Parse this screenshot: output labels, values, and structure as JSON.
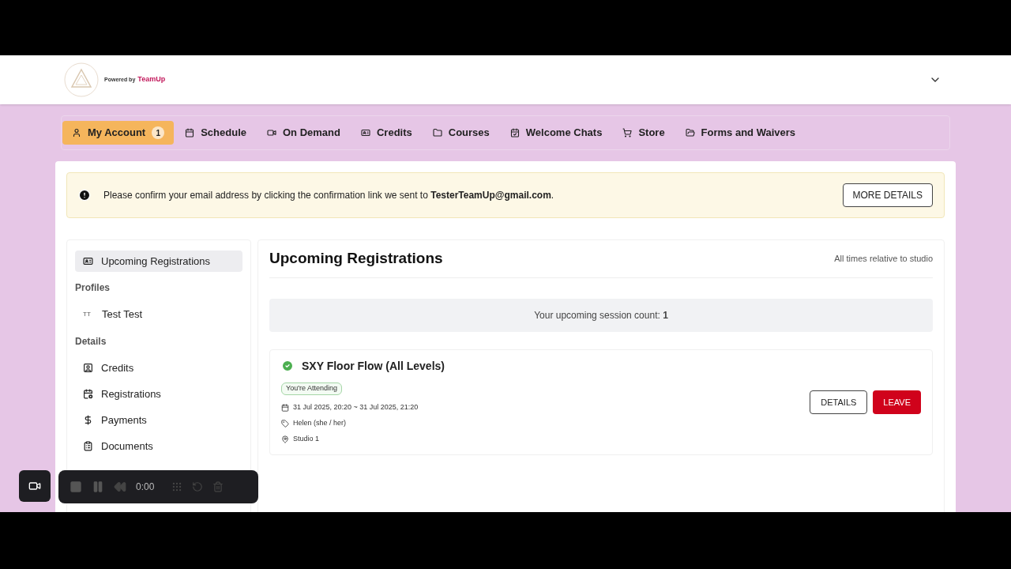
{
  "header": {
    "powered_by": "Powered by",
    "brand": "TeamUp"
  },
  "nav": [
    {
      "label": "My Account",
      "selected": true,
      "badge": "1"
    },
    {
      "label": "Schedule",
      "selected": false
    },
    {
      "label": "On Demand",
      "selected": false
    },
    {
      "label": "Credits",
      "selected": false
    },
    {
      "label": "Courses",
      "selected": false
    },
    {
      "label": "Welcome Chats",
      "selected": false
    },
    {
      "label": "Store",
      "selected": false
    },
    {
      "label": "Forms and Waivers",
      "selected": false
    }
  ],
  "alert": {
    "text": "Please confirm your email address by clicking the confirmation link we sent to **TesterTeamUp@gmail.com**.",
    "button": "MORE DETAILS"
  },
  "sidebar": [
    {
      "kind": "item",
      "label": "Upcoming Registrations",
      "selected": true
    },
    {
      "kind": "heading",
      "label": "Profiles"
    },
    {
      "kind": "profile",
      "initials": "TT",
      "label": "Test Test",
      "selected": false
    },
    {
      "kind": "heading",
      "label": "Details"
    },
    {
      "kind": "item",
      "label": "Credits",
      "selected": false
    },
    {
      "kind": "item",
      "label": "Registrations",
      "selected": false
    },
    {
      "kind": "item",
      "label": "Payments",
      "selected": false
    },
    {
      "kind": "item",
      "label": "Documents",
      "selected": false
    }
  ],
  "main": {
    "title": "Upcoming Registrations",
    "note": "All times relative to studio",
    "count_text": "Your upcoming session count: **1**",
    "sessions": [
      {
        "title": "SXY Floor Flow (All Levels)",
        "status": "You're Attending",
        "when": "31 Jul 2025, 20:20 ~ 31 Jul 2025, 21:20",
        "instructor": "Helen (she / her)",
        "location": "Studio 1",
        "buttons": [
          "DETAILS",
          "LEAVE"
        ]
      }
    ]
  },
  "recorder": {
    "time": "0:00"
  }
}
